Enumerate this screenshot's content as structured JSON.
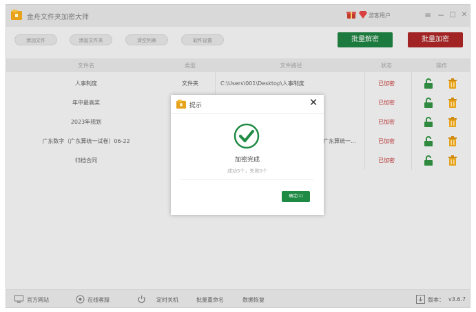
{
  "app": {
    "title": "金舟文件夹加密大师",
    "user_label": "游客用户",
    "icons": {
      "logo": "folder-icon",
      "gift": "gift-icon",
      "vip": "diamond-icon"
    },
    "window_controls": {
      "menu": "≡",
      "minimize": "−",
      "maximize": "□",
      "close": "✕"
    }
  },
  "toolbar": {
    "buttons": [
      "添加文件",
      "添加文件夹",
      "清空列表",
      "软件设置"
    ],
    "batch_decrypt": "批量解密",
    "batch_encrypt": "批量加密"
  },
  "table": {
    "headers": [
      "文件名",
      "类型",
      "文件路径",
      "状态",
      "操作"
    ],
    "rows": [
      {
        "name": "人事制度",
        "type": "文件夹",
        "path": "C:\\Users\\001\\Desktop\\人事制度",
        "status": "已加密"
      },
      {
        "name": "年中最高奖",
        "type": "",
        "path": "",
        "status": "已加密"
      },
      {
        "name": "2023年规划",
        "type": "",
        "path": "",
        "status": "已加密"
      },
      {
        "name": "广东数字（广东算统一试卷）06-22",
        "type": "",
        "path": "广东算统一...",
        "status": "已加密"
      },
      {
        "name": "归档合同",
        "type": "",
        "path": "",
        "status": "已加密"
      }
    ]
  },
  "footer": {
    "items": [
      "官方网站",
      "在线客服",
      "定时关机",
      "批量重命名",
      "数据恢复"
    ],
    "version_label": "版本：",
    "version": "v3.6.7"
  },
  "dialog": {
    "title": "提示",
    "message": "加密完成",
    "sub_message": "成功5个，失败0个",
    "ok_label": "确定(1)"
  },
  "colors": {
    "decrypt_green": "#1d7a3e",
    "encrypt_red": "#a12323",
    "status_red": "#b83838",
    "ok_green": "#1f8a44",
    "check_green": "#1f8a44"
  }
}
